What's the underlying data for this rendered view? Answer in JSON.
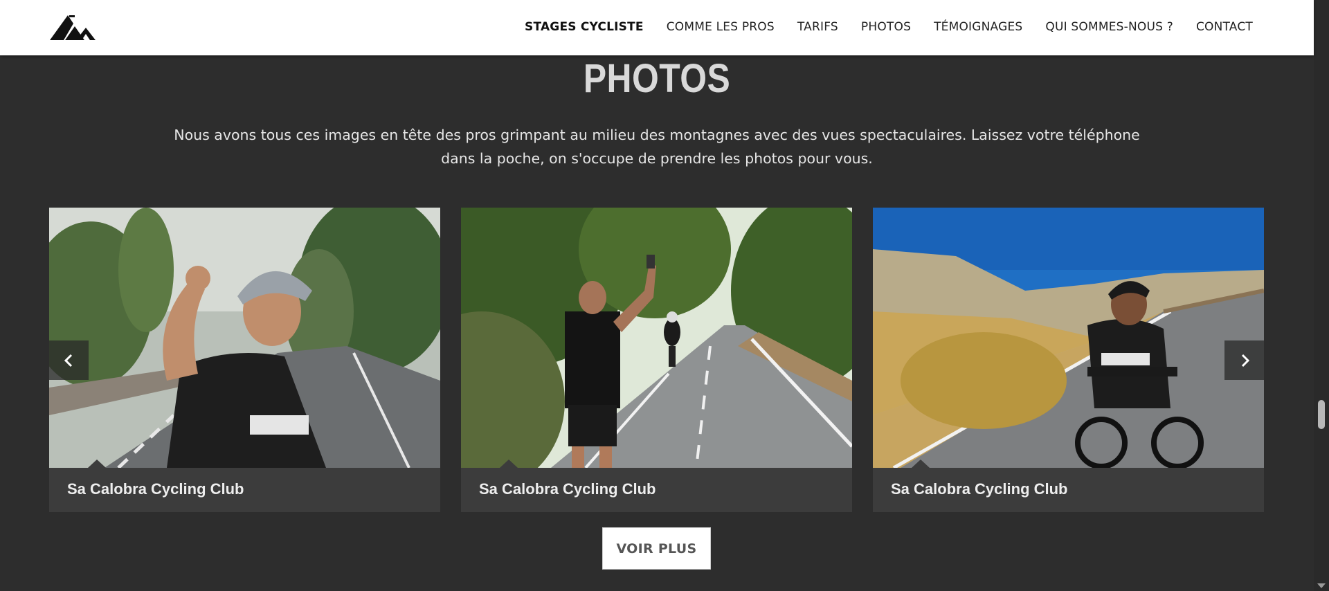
{
  "header": {
    "logo_icon": "mountain-logo-icon",
    "nav": [
      {
        "label": "STAGES CYCLISTE",
        "active": true
      },
      {
        "label": "COMME LES PROS",
        "active": false
      },
      {
        "label": "TARIFS",
        "active": false
      },
      {
        "label": "PHOTOS",
        "active": false
      },
      {
        "label": "TÉMOIGNAGES",
        "active": false
      },
      {
        "label": "QUI SOMMES-NOUS ?",
        "active": false
      },
      {
        "label": "CONTACT",
        "active": false
      }
    ]
  },
  "section": {
    "title": "PHOTOS",
    "intro_line1": "Nous avons tous ces images en tête des pros grimpant au milieu des montagnes avec des vues spectaculaires. Laissez votre téléphone",
    "intro_line2": "dans la poche, on s'occupe de prendre les photos pour vous."
  },
  "gallery": {
    "cards": [
      {
        "caption": "Sa Calobra Cycling Club",
        "image": "cyclist-celebrating-photo"
      },
      {
        "caption": "Sa Calobra Cycling Club",
        "image": "man-photographing-cyclist-photo"
      },
      {
        "caption": "Sa Calobra Cycling Club",
        "image": "cyclist-riding-coast-road-photo"
      }
    ],
    "prev_icon": "chevron-left-icon",
    "next_icon": "chevron-right-icon"
  },
  "button": {
    "label": "VOIR PLUS"
  },
  "colors": {
    "background": "#2d2d2d",
    "header": "#ffffff",
    "card": "#3c3c3c",
    "title": "#d9d9d9"
  }
}
